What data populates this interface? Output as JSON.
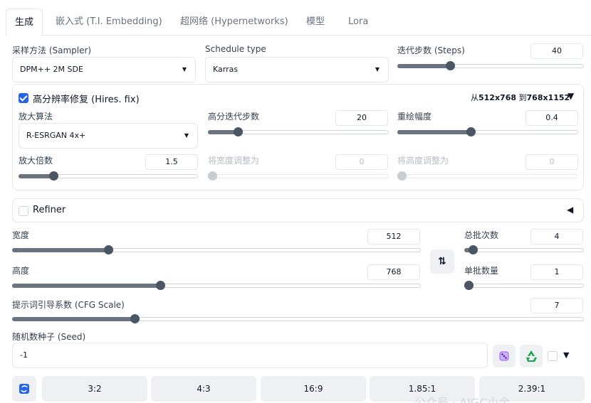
{
  "tabs": [
    {
      "label": "生成"
    },
    {
      "label": "嵌入式 (T.I. Embedding)"
    },
    {
      "label": "超网络 (Hypernetworks)"
    },
    {
      "label": "模型"
    },
    {
      "label": "Lora"
    }
  ],
  "sampler": {
    "label": "采样方法 (Sampler)",
    "value": "DPM++ 2M SDE"
  },
  "schedule": {
    "label": "Schedule type",
    "value": "Karras"
  },
  "steps": {
    "label": "迭代步数 (Steps)",
    "value": "40",
    "fraction": 0.27
  },
  "hires": {
    "label": "高分辨率修复 (Hires. fix)",
    "checked": true,
    "summary_prefix": "从",
    "summary_from": "512x768",
    "summary_mid": " 到",
    "summary_to": "768x1152",
    "collapse_glyph": "▼",
    "upscaler": {
      "label": "放大算法",
      "value": "R-ESRGAN 4x+"
    },
    "hires_steps": {
      "label": "高分迭代步数",
      "value": "20",
      "fraction": 0.15
    },
    "denoise": {
      "label": "重绘幅度",
      "value": "0.4",
      "fraction": 0.4
    },
    "upscale_by": {
      "label": "放大倍数",
      "value": "1.5",
      "fraction": 0.18
    },
    "resize_width": {
      "label": "将宽度调整为",
      "value": "0",
      "fraction": 0.0
    },
    "resize_height": {
      "label": "将高度调整为",
      "value": "0",
      "fraction": 0.0
    }
  },
  "refiner": {
    "label": "Refiner",
    "checked": false,
    "expand_glyph": "◀"
  },
  "width": {
    "label": "宽度",
    "value": "512",
    "fraction": 0.23
  },
  "height": {
    "label": "高度",
    "value": "768",
    "fraction": 0.36
  },
  "swap_glyph": "⇅",
  "batch_count": {
    "label": "总批次数",
    "value": "4",
    "fraction": 0.04
  },
  "batch_size": {
    "label": "单批数量",
    "value": "1",
    "fraction": 0.0
  },
  "cfg": {
    "label": "提示词引导系数 (CFG Scale)",
    "value": "7",
    "fraction": 0.21
  },
  "seed": {
    "label": "随机数种子 (Seed)",
    "value": "-1",
    "extra_glyph": "▼"
  },
  "ratios": [
    "3:2",
    "4:3",
    "16:9",
    "1.85:1",
    "2.39:1"
  ],
  "watermark": "公众号 · AIGC小余",
  "colors": {
    "accent": "#2563eb",
    "dice": "#a855f7",
    "recycle": "#16a34a"
  }
}
